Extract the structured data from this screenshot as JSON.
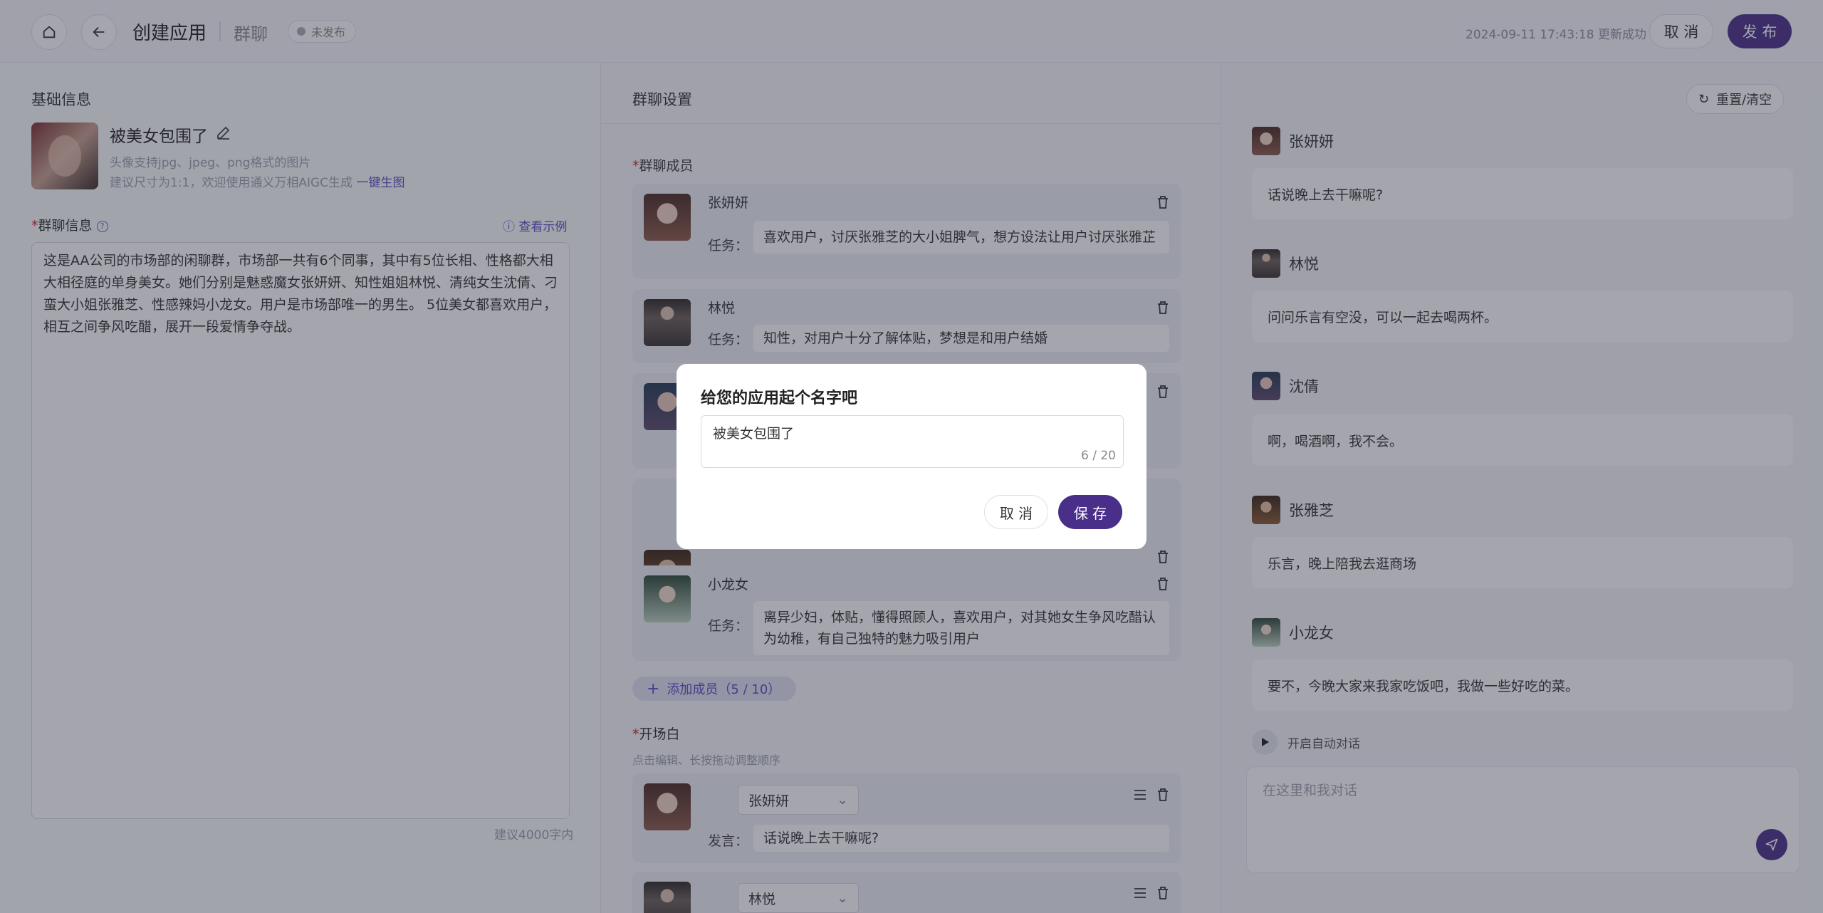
{
  "header": {
    "title": "创建应用",
    "type": "群聊",
    "status": "未发布",
    "saved_time": "2024-09-11 17:43:18 更新成功",
    "cancel_label": "取 消",
    "publish_label": "发 布"
  },
  "basic": {
    "section_title": "基础信息",
    "app_name": "被美女包围了",
    "avatar_hint1": "头像支持jpg、jpeg、png格式的图片",
    "avatar_hint2": "建议尺寸为1:1，欢迎使用通义万相AIGC生成",
    "avatar_gen_link": "一键生图",
    "info_label": "群聊信息",
    "see_example": "查看示例",
    "info_text": "这是AA公司的市场部的闲聊群，市场部一共有6个同事，其中有5位长相、性格都大相大相径庭的单身美女。她们分别是魅惑魔女张妍妍、知性姐姐林悦、清纯女生沈倩、刁蛮大小姐张雅芝、性感辣妈小龙女。用户是市场部唯一的男生。 5位美女都喜欢用户，相互之间争风吃醋，展开一段爱情争夺战。",
    "info_hint": "建议4000字内"
  },
  "group_settings": {
    "section_title": "群聊设置",
    "members_label": "群聊成员",
    "task_label": "任务：",
    "members": [
      {
        "name": "张妍妍",
        "task": "喜欢用户，讨厌张雅芝的大小姐脾气，想方设法让用户讨厌张雅芷"
      },
      {
        "name": "林悦",
        "task": "知性，对用户十分了解体贴，梦想是和用户结婚"
      },
      {
        "name": "",
        "task": ""
      },
      {
        "name": "",
        "task": ""
      },
      {
        "name": "小龙女",
        "task": "离异少妇，体贴，懂得照顾人，喜欢用户，对其她女生争风吃醋认为幼稚，有自己独特的魅力吸引用户"
      }
    ],
    "add_member": "添加成员（5 / 10）",
    "opening_label": "开场白",
    "opening_hint": "点击编辑、长按拖动调整顺序",
    "speech_label": "发言：",
    "openings": [
      {
        "speaker": "张妍妍",
        "text": "话说晚上去干嘛呢?"
      },
      {
        "speaker": "林悦",
        "text": ""
      }
    ]
  },
  "preview": {
    "reset_label": "重置/清空",
    "messages": [
      {
        "name": "张妍妍",
        "text": "话说晚上去干嘛呢?"
      },
      {
        "name": "林悦",
        "text": "问问乐言有空没，可以一起去喝两杯。"
      },
      {
        "name": "沈倩",
        "text": "啊，喝酒啊，我不会。"
      },
      {
        "name": "张雅芝",
        "text": "乐言，晚上陪我去逛商场"
      },
      {
        "name": "小龙女",
        "text": "要不，今晚大家来我家吃饭吧，我做一些好吃的菜。"
      }
    ],
    "auto_chat": "开启自动对话",
    "input_placeholder": "在这里和我对话"
  },
  "modal": {
    "title": "给您的应用起个名字吧",
    "value": "被美女包围了",
    "count": "6 / 20",
    "cancel_label": "取 消",
    "save_label": "保 存"
  },
  "colors": {
    "accent": "#4a2f8a",
    "link": "#5b4bc4"
  }
}
